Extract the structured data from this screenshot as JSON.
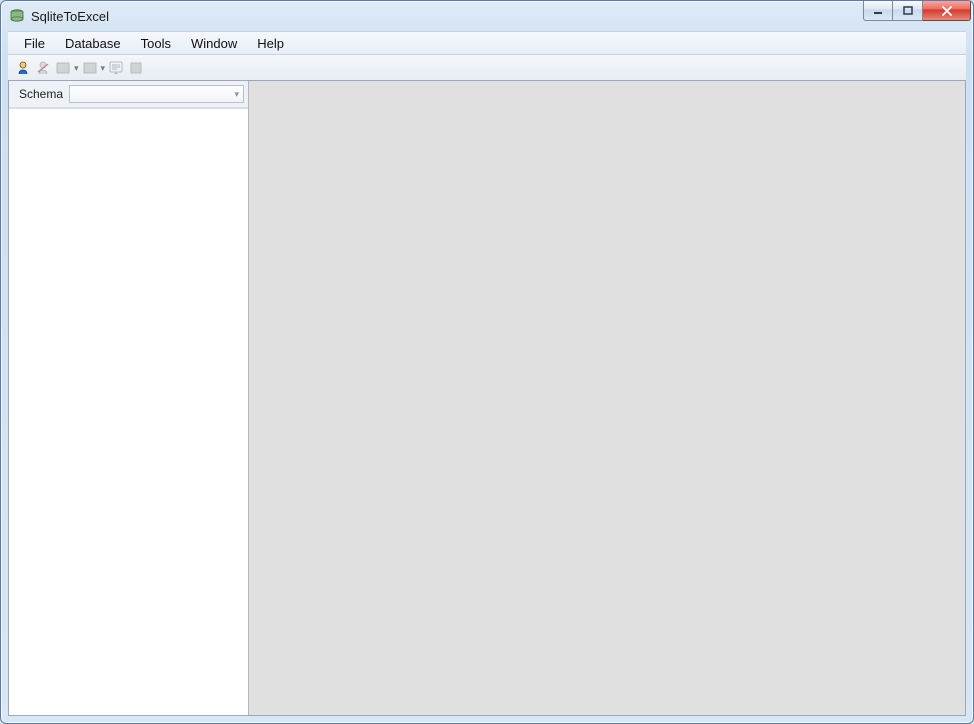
{
  "window": {
    "title": "SqliteToExcel"
  },
  "menubar": {
    "items": [
      "File",
      "Database",
      "Tools",
      "Window",
      "Help"
    ]
  },
  "toolbar": {
    "buttons": [
      {
        "name": "connect-icon",
        "enabled": true
      },
      {
        "name": "disconnect-icon",
        "enabled": false
      },
      {
        "name": "import-icon",
        "enabled": false,
        "dropdown": true
      },
      {
        "name": "export-icon",
        "enabled": false,
        "dropdown": true
      },
      {
        "name": "query-icon",
        "enabled": false
      },
      {
        "name": "stop-icon",
        "enabled": false
      }
    ]
  },
  "sidebar": {
    "schema_label": "Schema",
    "schema_value": ""
  }
}
